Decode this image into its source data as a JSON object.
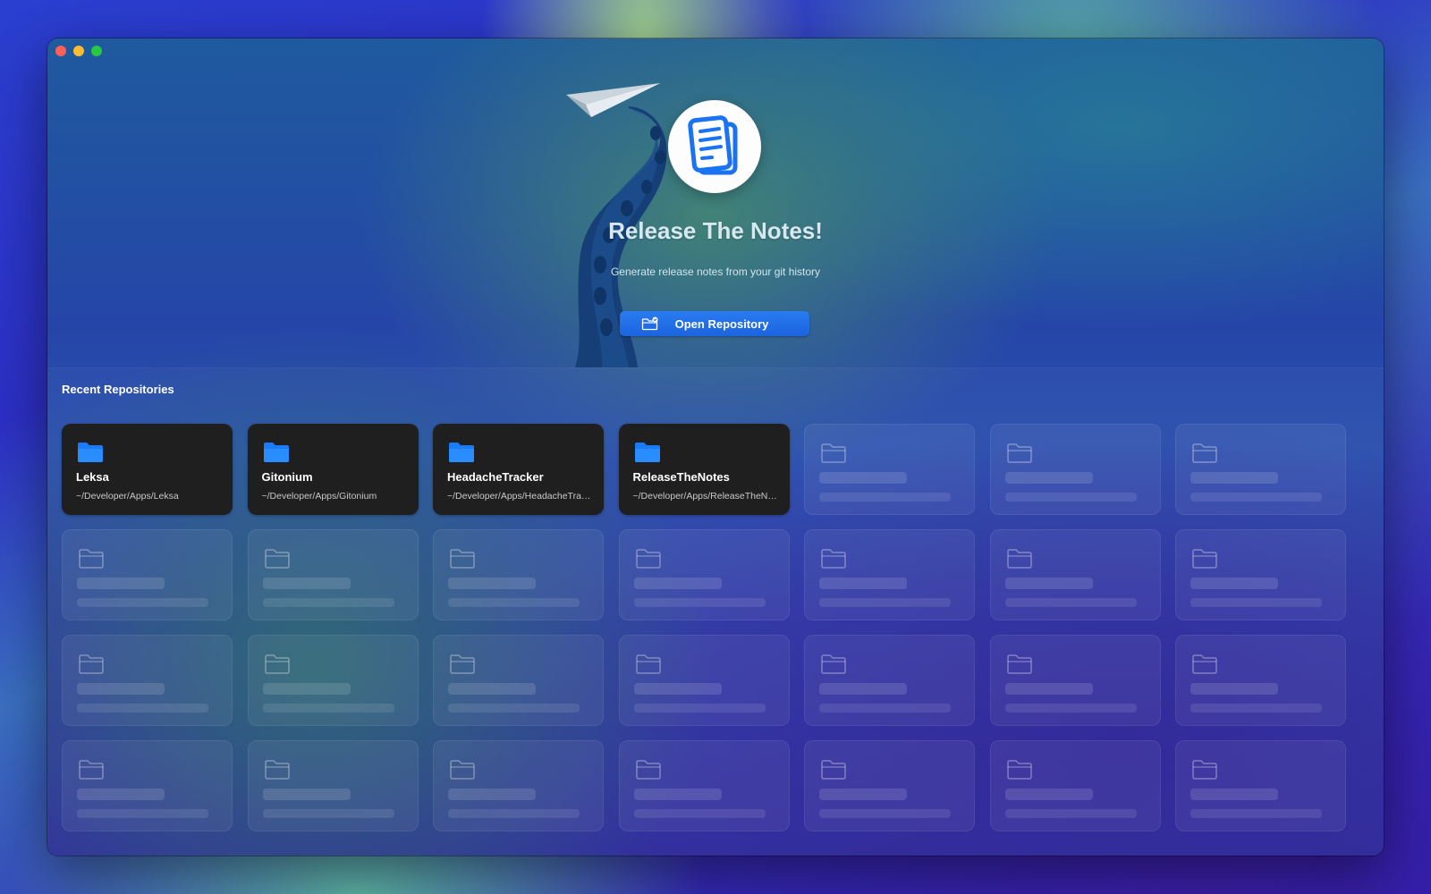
{
  "window": {
    "controls": [
      "close",
      "minimize",
      "zoom"
    ]
  },
  "hero": {
    "title": "Release The Notes!",
    "subtitle": "Generate release notes from your git history",
    "open_button_label": "Open Repository",
    "app_icon": "document-icon",
    "button_icon": "folder-badge-icon"
  },
  "recent": {
    "title": "Recent Repositories",
    "repositories": [
      {
        "name": "Leksa",
        "path": "~/Developer/Apps/Leksa"
      },
      {
        "name": "Gitonium",
        "path": "~/Developer/Apps/Gitonium"
      },
      {
        "name": "HeadacheTracker",
        "path": "~/Developer/Apps/HeadacheTracker"
      },
      {
        "name": "ReleaseTheNotes",
        "path": "~/Developer/Apps/ReleaseTheNotes"
      }
    ],
    "placeholder_count": 24
  },
  "colors": {
    "accent": "#1b6ff0",
    "folder_blue": "#1a7af8",
    "card_bg": "#1f1f1f"
  }
}
